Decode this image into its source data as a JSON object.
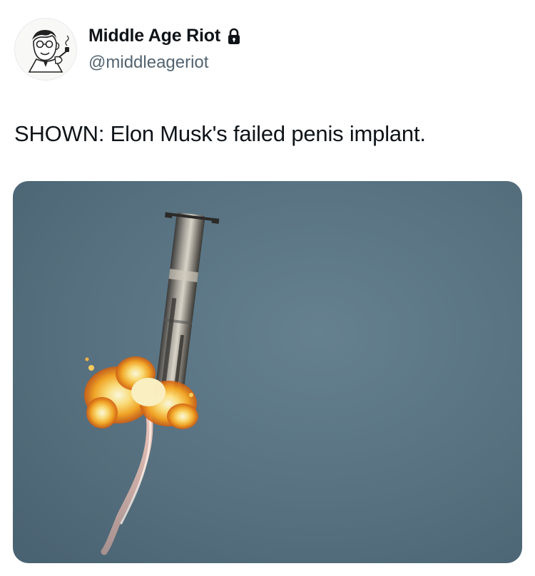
{
  "author": {
    "display_name": "Middle Age Riot",
    "handle": "@middleageriot",
    "protected": true
  },
  "tweet": {
    "text": "SHOWN: Elon Musk's failed penis implant."
  },
  "media": {
    "type": "photo"
  },
  "icons": {
    "avatar": "cartoon-man-with-pipe-avatar",
    "lock": "lock-icon"
  },
  "colors": {
    "text": "#0f1419",
    "secondary_text": "#536471",
    "sky": "#57707f"
  }
}
